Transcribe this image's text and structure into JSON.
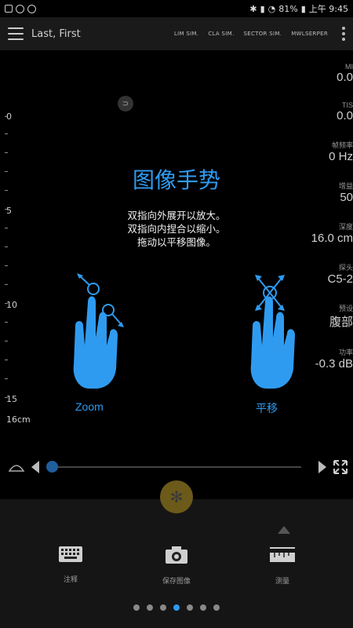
{
  "status": {
    "battery": "81%",
    "time": "上午 9:45"
  },
  "header": {
    "patient": "Last, First",
    "tabs": [
      "LIM SIM.",
      "CLA SIM.",
      "SECTOR SIM.",
      "MWLSERPER"
    ]
  },
  "ruler": {
    "labels": [
      "0",
      "5",
      "10",
      "15",
      "16cm"
    ]
  },
  "params": [
    {
      "label": "MI",
      "value": "0.0"
    },
    {
      "label": "TIS",
      "value": "0.0"
    },
    {
      "label": "帧频率",
      "value": "0 Hz"
    },
    {
      "label": "增益",
      "value": "50"
    },
    {
      "label": "深度",
      "value": "16.0 cm"
    },
    {
      "label": "探头",
      "value": "C5-2"
    },
    {
      "label": "预设",
      "value": "腹部"
    },
    {
      "label": "功率",
      "value": "-0.3 dB"
    }
  ],
  "gesture": {
    "title": "图像手势",
    "lines": [
      "双指向外展开以放大。",
      "双指向内捏合以缩小。",
      "拖动以平移图像。"
    ],
    "zoom_label": "Zoom",
    "pan_label": "平移"
  },
  "bottom": {
    "buttons": [
      {
        "label": "注释"
      },
      {
        "label": "保存图像"
      },
      {
        "label": "测量"
      }
    ],
    "page_dots": 7,
    "active_dot": 3
  },
  "colors": {
    "accent": "#2f9bf0",
    "freeze": "#6b5a1a"
  }
}
